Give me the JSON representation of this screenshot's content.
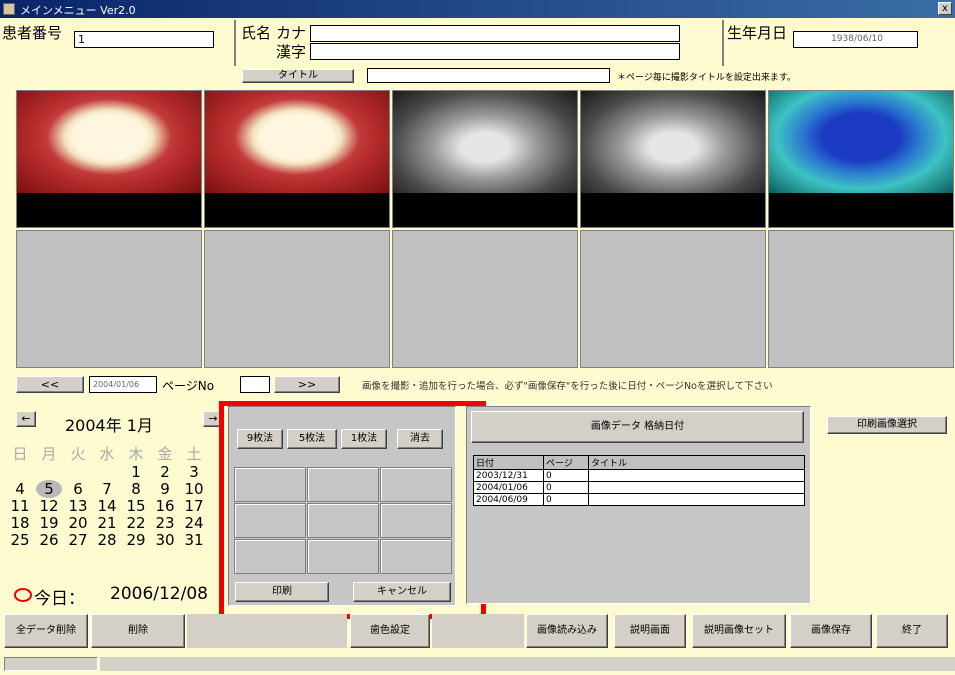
{
  "window": {
    "title": "メインメニュー Ver2.0",
    "close": "x"
  },
  "header": {
    "patient_no_label": "患者番号",
    "patient_no_value": "1",
    "name_label": "氏名",
    "kana_label": "カナ",
    "kanji_label": "漢字",
    "kana_value": "",
    "kanji_value": "",
    "birth_label": "生年月日",
    "birth_value": "1938/06/10"
  },
  "title_row": {
    "title_label": "タイトル",
    "title_value": "",
    "hint": "＊ページ毎に撮影タイトルを設定出来ます。"
  },
  "photos": [
    {
      "name": "intraoral-smile-photo-1",
      "kind": "teeth"
    },
    {
      "name": "intraoral-smile-photo-2",
      "kind": "teeth"
    },
    {
      "name": "panoramic-xray-photo-1",
      "kind": "xray"
    },
    {
      "name": "panoramic-xray-photo-2",
      "kind": "xray"
    },
    {
      "name": "blue-scan-photo",
      "kind": "blue"
    }
  ],
  "page_nav": {
    "prev": "<<",
    "date": "2004/01/06",
    "page_label": "ページNo",
    "page_value": "",
    "next": ">>",
    "notice": "画像を撮影・追加を行った場合、必ず\"画像保存\"を行った後に日付・ページNoを選択して下さい"
  },
  "calendar": {
    "prev": "←",
    "month": "2004年 1月",
    "next": "→",
    "weekdays": [
      "日",
      "月",
      "火",
      "水",
      "木",
      "金",
      "土"
    ],
    "rows": [
      [
        "",
        "",
        "",
        "",
        "1",
        "2",
        "3"
      ],
      [
        "4",
        "5",
        "6",
        "7",
        "8",
        "9",
        "10"
      ],
      [
        "11",
        "12",
        "13",
        "14",
        "15",
        "16",
        "17"
      ],
      [
        "18",
        "19",
        "20",
        "21",
        "22",
        "23",
        "24"
      ],
      [
        "25",
        "26",
        "27",
        "28",
        "29",
        "30",
        "31"
      ]
    ],
    "selected": "5",
    "today_label": "今日：",
    "today_value": "2006/12/08"
  },
  "layout_panel": {
    "tabs": [
      "9枚法",
      "5枚法",
      "1枚法",
      "消去"
    ],
    "print": "印刷",
    "cancel": "キャンセル"
  },
  "image_data": {
    "header": "画像データ 格納日付",
    "columns": [
      "日付",
      "ページ",
      "タイトル"
    ],
    "rows": [
      [
        "2003/12/31",
        "0",
        ""
      ],
      [
        "2004/01/06",
        "0",
        ""
      ],
      [
        "2004/06/09",
        "0",
        ""
      ]
    ]
  },
  "print_select": "印刷画像選択",
  "footer": {
    "buttons": [
      "全データ削除",
      "削除",
      "歯色設定",
      "画像読み込み",
      "説明画面",
      "説明画像セット",
      "画像保存",
      "終了"
    ]
  },
  "colors": {
    "window_bg": "#fffbd0",
    "highlight": "#f20000",
    "titlebar": "#0a246a"
  }
}
